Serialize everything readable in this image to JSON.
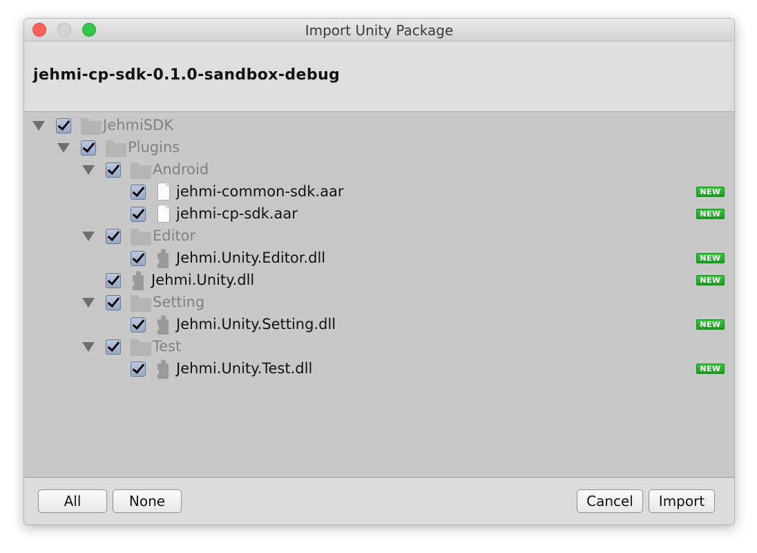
{
  "window": {
    "title": "Import Unity Package"
  },
  "package": {
    "name": "jehmi-cp-sdk-0.1.0-sandbox-debug"
  },
  "tree": [
    {
      "label": "JehmiSDK",
      "type": "folder",
      "level": 0,
      "expanded": true,
      "checked": true
    },
    {
      "label": "Plugins",
      "type": "folder",
      "level": 1,
      "expanded": true,
      "checked": true
    },
    {
      "label": "Android",
      "type": "folder",
      "level": 2,
      "expanded": true,
      "checked": true
    },
    {
      "label": "jehmi-common-sdk.aar",
      "type": "file",
      "level": 3,
      "checked": true,
      "badge": "NEW"
    },
    {
      "label": "jehmi-cp-sdk.aar",
      "type": "file",
      "level": 3,
      "checked": true,
      "badge": "NEW"
    },
    {
      "label": "Editor",
      "type": "folder",
      "level": 2,
      "expanded": true,
      "checked": true
    },
    {
      "label": "Jehmi.Unity.Editor.dll",
      "type": "dll",
      "level": 3,
      "checked": true,
      "badge": "NEW"
    },
    {
      "label": "Jehmi.Unity.dll",
      "type": "dll",
      "level": 2,
      "checked": true,
      "badge": "NEW"
    },
    {
      "label": "Setting",
      "type": "folder",
      "level": 2,
      "expanded": true,
      "checked": true
    },
    {
      "label": "Jehmi.Unity.Setting.dll",
      "type": "dll",
      "level": 3,
      "checked": true,
      "badge": "NEW"
    },
    {
      "label": "Test",
      "type": "folder",
      "level": 2,
      "expanded": true,
      "checked": true
    },
    {
      "label": "Jehmi.Unity.Test.dll",
      "type": "dll",
      "level": 3,
      "checked": true,
      "badge": "NEW"
    }
  ],
  "buttons": {
    "all": "All",
    "none": "None",
    "cancel": "Cancel",
    "import": "Import"
  },
  "colors": {
    "new_badge": "#22a829",
    "folder_text": "#808080",
    "tree_bg": "#c8c8c8"
  }
}
